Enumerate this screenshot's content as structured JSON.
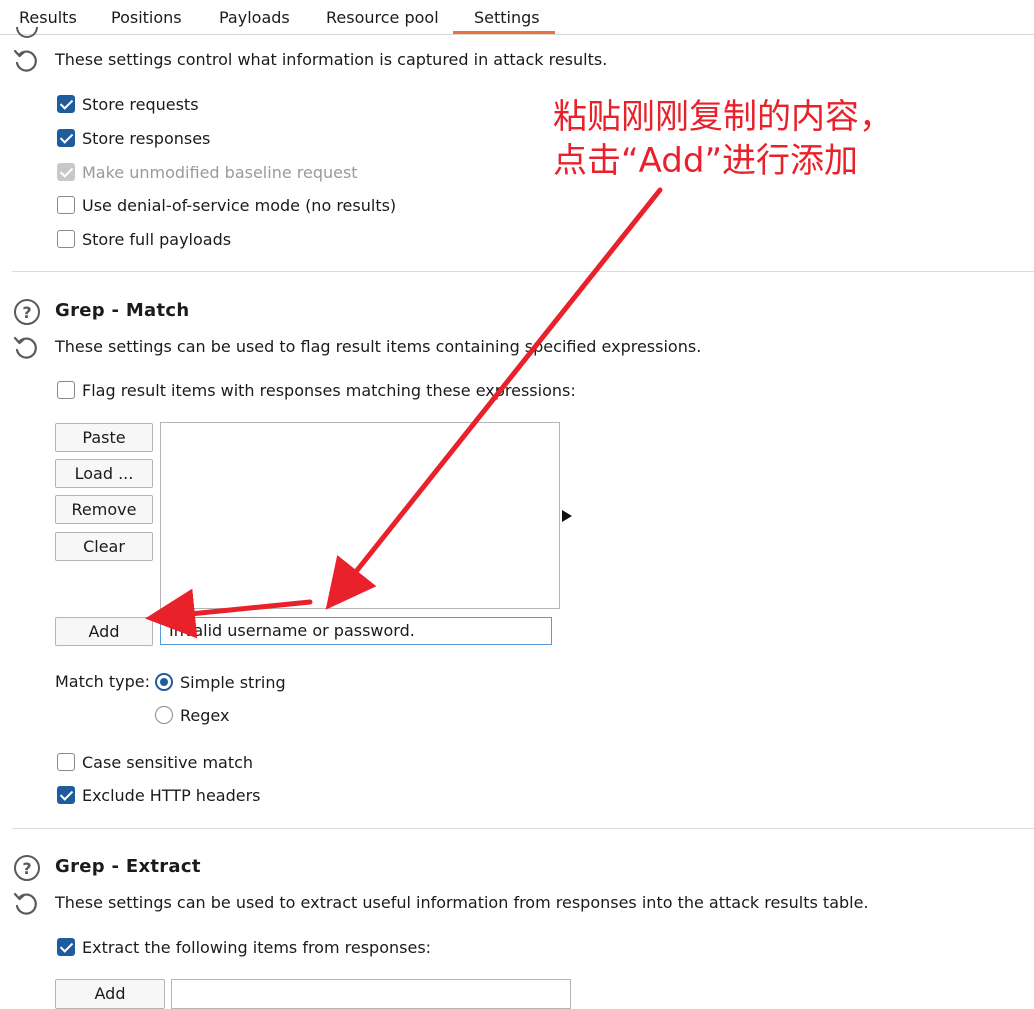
{
  "tabs": [
    {
      "label": "Results"
    },
    {
      "label": "Positions"
    },
    {
      "label": "Payloads"
    },
    {
      "label": "Resource pool"
    },
    {
      "label": "Settings"
    }
  ],
  "results_section": {
    "description": "These settings control what information is captured in attack results.",
    "options": [
      {
        "label": "Store requests",
        "checked": true
      },
      {
        "label": "Store responses",
        "checked": true
      },
      {
        "label": "Make unmodified baseline request",
        "checked": true,
        "disabled": true
      },
      {
        "label": "Use denial-of-service mode (no results)",
        "checked": false
      },
      {
        "label": "Store full payloads",
        "checked": false
      }
    ]
  },
  "grep_match": {
    "title": "Grep - Match",
    "description": "These settings can be used to flag result items containing specified expressions.",
    "flag_label": "Flag result items with responses matching these expressions:",
    "buttons": {
      "paste": "Paste",
      "load": "Load ...",
      "remove": "Remove",
      "clear": "Clear",
      "add": "Add"
    },
    "input_value": "Invalid username or password.",
    "match_type_label": "Match type:",
    "match_types": [
      {
        "label": "Simple string",
        "selected": true
      },
      {
        "label": "Regex",
        "selected": false
      }
    ],
    "case_sensitive_label": "Case sensitive match",
    "exclude_headers_label": "Exclude HTTP headers"
  },
  "grep_extract": {
    "title": "Grep - Extract",
    "description": "These settings can be used to extract useful information from responses into the attack results table.",
    "extract_label": "Extract the following items from responses:",
    "add_label": "Add"
  },
  "annotation": {
    "line1": "粘贴刚刚复制的内容，",
    "line2": "点击“Add”进行添加",
    "color": "#e8212b"
  },
  "colors": {
    "accent": "#e8733c",
    "checkbox_blue": "#1f5c9e"
  }
}
